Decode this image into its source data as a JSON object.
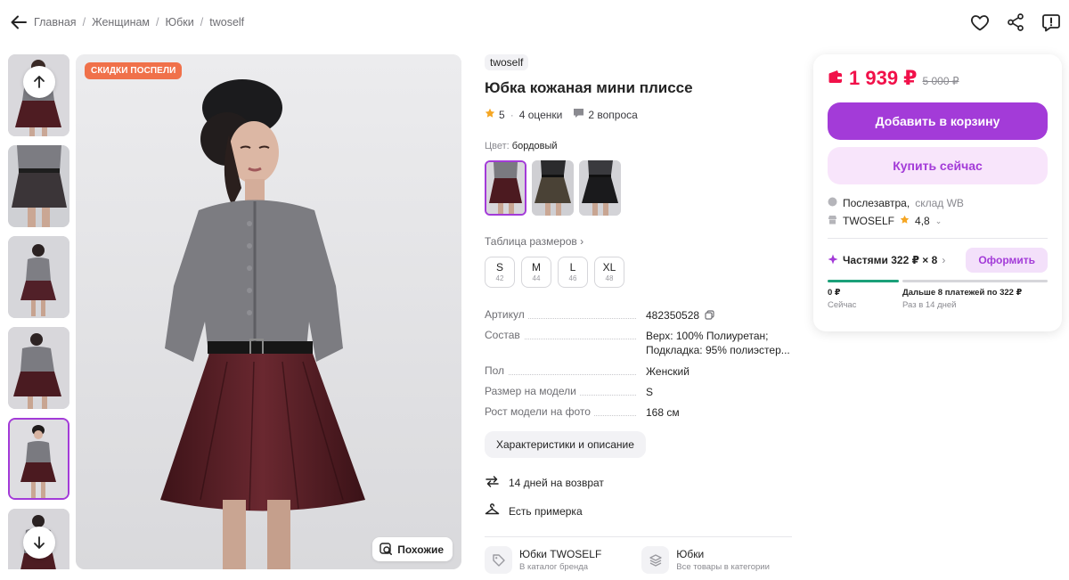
{
  "breadcrumbs": [
    "Главная",
    "Женщинам",
    "Юбки",
    "twoself"
  ],
  "icons": {
    "back": "arrow-left-icon",
    "favorite": "heart-icon",
    "share": "share-icon",
    "report": "report-icon",
    "scroll_up": "arrow-up-icon",
    "scroll_down": "arrow-down-icon",
    "similar": "similar-search-icon"
  },
  "gallery": {
    "promo_badge": "СКИДКИ ПОСПЕЛИ",
    "similar_label": "Похожие",
    "active_thumb_index": 4
  },
  "product": {
    "brand": "twoself",
    "title": "Юбка кожаная мини плиссе",
    "rating": "5",
    "reviews": "4 оценки",
    "questions": "2 вопроса",
    "color_label": "Цвет:",
    "color_value": "бордовый",
    "size_table_label": "Таблица размеров",
    "sizes": [
      {
        "label": "S",
        "ru": "42"
      },
      {
        "label": "M",
        "ru": "44"
      },
      {
        "label": "L",
        "ru": "46"
      },
      {
        "label": "XL",
        "ru": "48"
      }
    ],
    "specs": [
      {
        "label": "Артикул",
        "value": "482350528"
      },
      {
        "label": "Состав",
        "value": "Верх: 100% Полиуретан; Подкладка: 95% полиэстер..."
      },
      {
        "label": "Пол",
        "value": "Женский"
      },
      {
        "label": "Размер на модели",
        "value": "S"
      },
      {
        "label": "Рост модели на фото",
        "value": "168 см"
      }
    ],
    "characteristics_button": "Характеристики и описание",
    "features": [
      "14 дней на возврат",
      "Есть примерка"
    ],
    "bottom_links": [
      {
        "title": "Юбки TWOSELF",
        "subtitle": "В каталог бренда"
      },
      {
        "title": "Юбки",
        "subtitle": "Все товары в категории"
      }
    ]
  },
  "price_card": {
    "price": "1 939 ₽",
    "old_price": "5 000 ₽",
    "add_to_cart": "Добавить в корзину",
    "buy_now": "Купить сейчас",
    "delivery_day": "Послезавтра,",
    "delivery_warehouse": "склад WB",
    "seller_name": "TWOSELF",
    "seller_rating": "4,8",
    "installment_label": "Частями 322 ₽ × 8",
    "order_button": "Оформить",
    "pay_now_amount": "0 ₽",
    "pay_now_label": "Сейчас",
    "pay_later_amount": "Дальше 8 платежей по 322 ₽",
    "pay_later_label": "Раз в 14 дней"
  },
  "colors": {
    "accent": "#a33bd8",
    "price": "#f1114a",
    "promo": "#f0714a",
    "progress": "#1ba079"
  }
}
